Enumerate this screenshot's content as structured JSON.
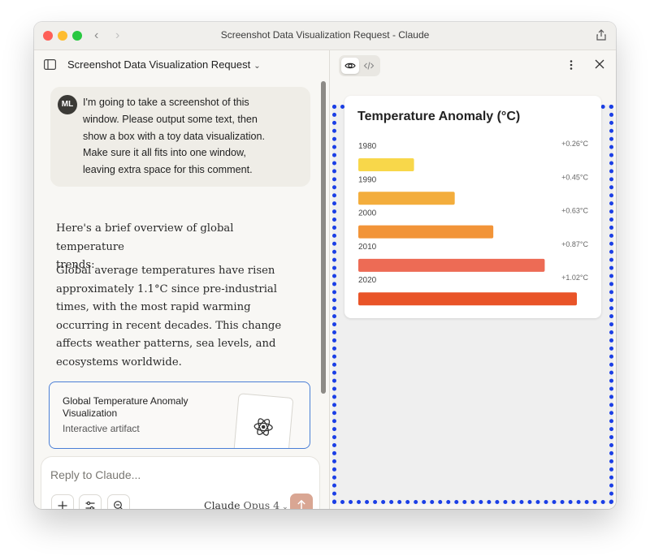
{
  "window": {
    "title": "Screenshot Data Visualization Request - Claude"
  },
  "header": {
    "conversation_title": "Screenshot Data Visualization Request"
  },
  "user_message": {
    "avatar_initials": "ML",
    "lines": [
      "I'm going to take a screenshot of this",
      "window. Please output some text, then",
      "show a box with a toy data visualization.",
      "Make sure it all fits into one window,",
      "leaving extra space for this comment."
    ]
  },
  "assistant_message": {
    "p1_lines": [
      "Here's a brief overview of global temperature",
      "trends:"
    ],
    "p2_lines": [
      "Global average temperatures have risen",
      "approximately 1.1°C since pre-industrial",
      "times, with the most rapid warming",
      "occurring in recent decades. This change",
      "affects weather patterns, sea levels, and",
      "ecosystems worldwide."
    ]
  },
  "artifact": {
    "title": "Global Temperature Anomaly Visualization",
    "subtitle": "Interactive artifact"
  },
  "composer": {
    "placeholder": "Reply to Claude...",
    "model_name": "Claude",
    "model_version": "Opus 4"
  },
  "icons": {
    "sidebar": "sidebar-icon",
    "share": "share-icon",
    "preview": "eye-icon",
    "code": "code-icon",
    "more": "more-vertical-icon",
    "close": "close-icon",
    "atom": "atom-icon",
    "plus": "plus-icon",
    "tools": "sliders-icon",
    "search": "search-icon",
    "send": "arrow-up-icon"
  },
  "colors": {
    "preview_border": "#1b3fe6",
    "send_button": "#d9a693",
    "artifact_border": "#4a7fd6"
  },
  "chart_data": {
    "type": "bar",
    "orientation": "horizontal",
    "title": "Temperature Anomaly (°C)",
    "categories": [
      "1980",
      "1990",
      "2000",
      "2010",
      "2020"
    ],
    "values": [
      0.26,
      0.45,
      0.63,
      0.87,
      1.02
    ],
    "value_labels": [
      "+0.26°C",
      "+0.45°C",
      "+0.63°C",
      "+0.87°C",
      "+1.02°C"
    ],
    "colors": [
      "#f8d74a",
      "#f3ad3c",
      "#f29438",
      "#ed6b55",
      "#e95428"
    ],
    "xlim": [
      0,
      1.02
    ],
    "grid": false,
    "legend": "none"
  }
}
